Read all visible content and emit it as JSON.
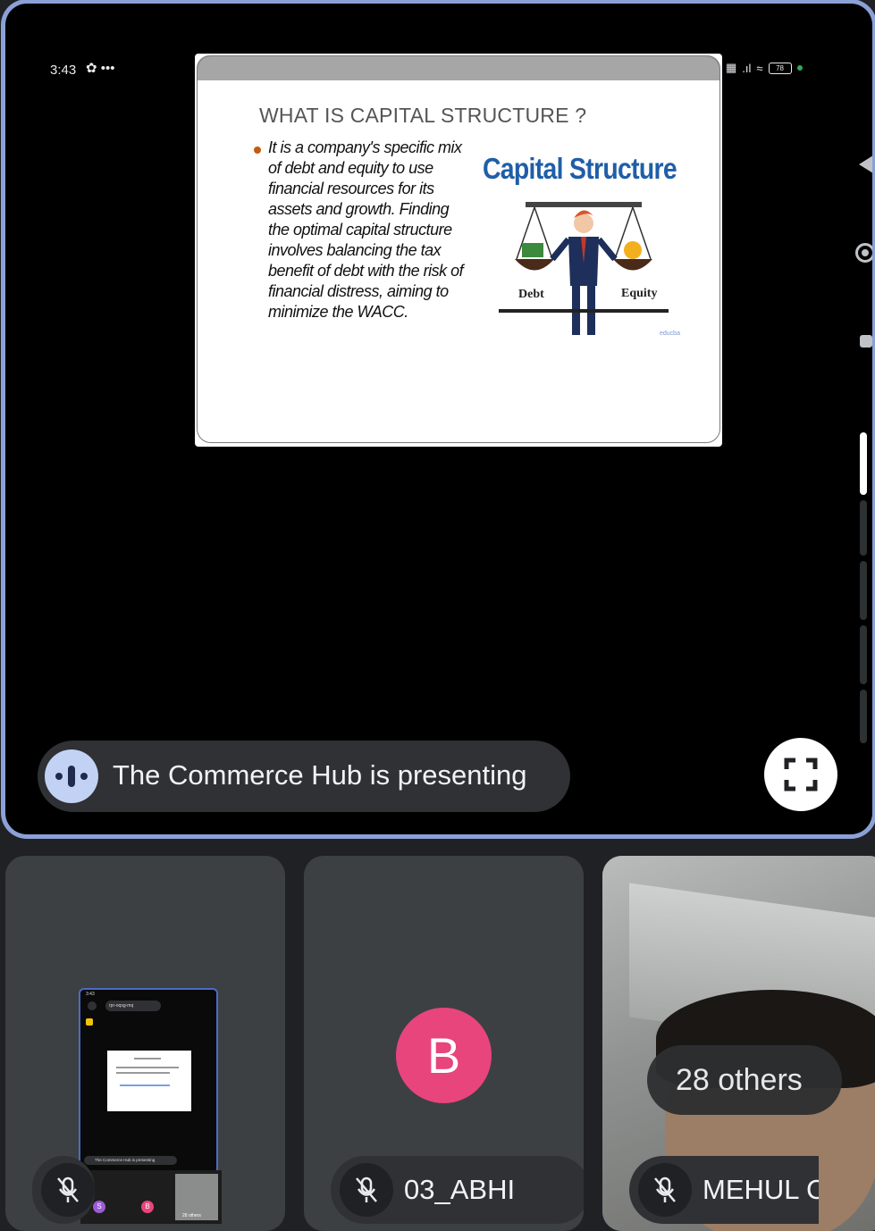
{
  "status_bar": {
    "time": "3:43",
    "extra": "•••",
    "battery": "78"
  },
  "slide": {
    "title": "WHAT IS CAPITAL STRUCTURE ?",
    "body": "It is a company's specific mix of debt and equity to use financial resources for its assets and growth. Finding the optimal capital structure involves balancing the tax benefit of debt with the risk of financial distress, aiming to minimize the WACC.",
    "image_title": "Capital Structure",
    "debt_label": "Debt",
    "equity_label": "Equity",
    "watermark": "educba"
  },
  "presenting": {
    "text": "The Commerce Hub is presenting"
  },
  "tiles": [
    {
      "name": "",
      "mini": {
        "time": "3:43",
        "address": "rpr-oqsg-mq",
        "pill": "The Commerce Hub is presenting",
        "avatars": [
          "S",
          "B"
        ],
        "others": "28 others"
      }
    },
    {
      "name": "03_ABHI",
      "avatar_letter": "B"
    },
    {
      "name": "MEHUL C",
      "others": "28 others"
    }
  ],
  "colors": {
    "stage_border": "#8ba0d6",
    "avatar_b": "#e8457c",
    "pill_icon_bg": "#c2d2f5",
    "cs_title": "#1f5ea8",
    "bullet": "#c55a11"
  }
}
